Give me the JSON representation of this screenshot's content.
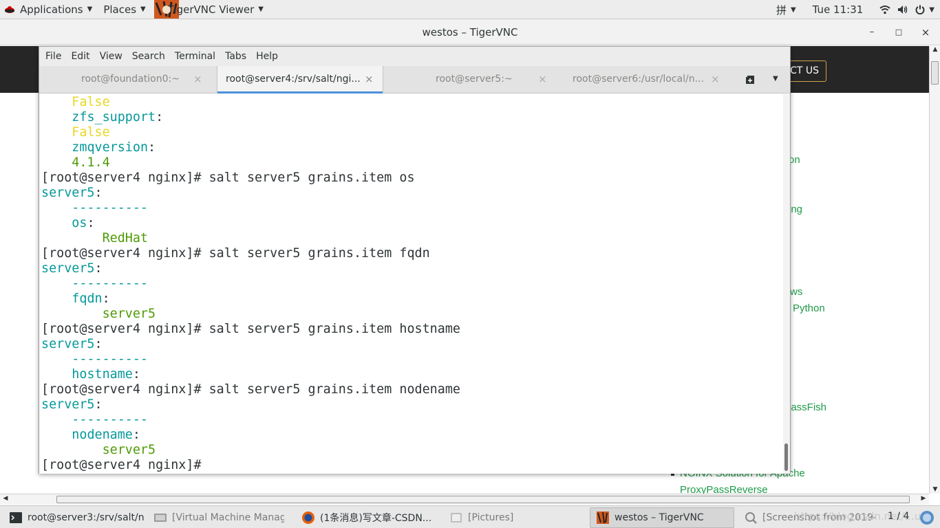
{
  "topbar": {
    "applications": "Applications",
    "places": "Places",
    "app_name": "TigerVNC Viewer",
    "input_method": "拼",
    "clock": "Tue 11:31"
  },
  "vnc_window": {
    "title": "westos – TigerVNC",
    "minimize": "–",
    "maximize": "□",
    "close": "×"
  },
  "background_page": {
    "contact": "CT US",
    "links": [
      "on",
      "ing",
      "ws",
      "Python",
      "lassFish",
      "NGINX Solution for Apache",
      "ProxyPassReverse"
    ]
  },
  "terminal": {
    "menu": [
      "File",
      "Edit",
      "View",
      "Search",
      "Terminal",
      "Tabs",
      "Help"
    ],
    "tabs": [
      {
        "label": "root@foundation0:~",
        "close": "×"
      },
      {
        "label": "root@server4:/srv/salt/ngi...",
        "close": "×"
      },
      {
        "label": "root@server5:~",
        "close": "×"
      },
      {
        "label": "root@server6:/usr/local/n...",
        "close": "×"
      }
    ],
    "lines": [
      {
        "text": "    False",
        "color": "yellow"
      },
      {
        "text": "zfs_support",
        "suffix": ":",
        "indent": 4,
        "color": "cyan"
      },
      {
        "text": "    False",
        "color": "yellow"
      },
      {
        "text": "zmqversion",
        "suffix": ":",
        "indent": 4,
        "color": "cyan"
      },
      {
        "text": "    4.1.4",
        "color": "green"
      },
      {
        "text": "[root@server4 nginx]# salt server5 grains.item os",
        "color": "fg"
      },
      {
        "text": "server5",
        "suffix": ":",
        "indent": 0,
        "color": "cyan"
      },
      {
        "text": "    ----------",
        "color": "cyan"
      },
      {
        "text": "os",
        "suffix": ":",
        "indent": 4,
        "color": "cyan"
      },
      {
        "text": "        RedHat",
        "color": "green"
      },
      {
        "text": "[root@server4 nginx]# salt server5 grains.item fqdn",
        "color": "fg"
      },
      {
        "text": "server5",
        "suffix": ":",
        "indent": 0,
        "color": "cyan"
      },
      {
        "text": "    ----------",
        "color": "cyan"
      },
      {
        "text": "fqdn",
        "suffix": ":",
        "indent": 4,
        "color": "cyan"
      },
      {
        "text": "        server5",
        "color": "green"
      },
      {
        "text": "[root@server4 nginx]# salt server5 grains.item hostname",
        "color": "fg"
      },
      {
        "text": "server5",
        "suffix": ":",
        "indent": 0,
        "color": "cyan"
      },
      {
        "text": "    ----------",
        "color": "cyan"
      },
      {
        "text": "hostname",
        "suffix": ":",
        "indent": 4,
        "color": "cyan"
      },
      {
        "text": "[root@server4 nginx]# salt server5 grains.item nodename",
        "color": "fg"
      },
      {
        "text": "server5",
        "suffix": ":",
        "indent": 0,
        "color": "cyan"
      },
      {
        "text": "    ----------",
        "color": "cyan"
      },
      {
        "text": "nodename",
        "suffix": ":",
        "indent": 4,
        "color": "cyan"
      },
      {
        "text": "        server5",
        "color": "green"
      },
      {
        "text": "[root@server4 nginx]# ",
        "color": "fg"
      }
    ]
  },
  "taskbar": {
    "items": [
      {
        "label": "root@server3:/srv/salt/n...",
        "icon": "terminal-icon"
      },
      {
        "label": "[Virtual Machine Manager]",
        "icon": "virt-manager-icon"
      },
      {
        "label": "(1条消息)写文章-CSDN...",
        "icon": "firefox-icon"
      },
      {
        "label": "[Pictures]",
        "icon": "folder-icon"
      },
      {
        "label": "westos – TigerVNC",
        "icon": "tigervnc-icon"
      },
      {
        "label": "[Screenshot from 2019-...",
        "icon": "screenshot-icon"
      }
    ],
    "workspace": "1 / 4",
    "watermark": "https://blog.csdn.net/...u..."
  },
  "colors": {
    "terminal_cyan": "#06989a",
    "terminal_yellow": "#e8d823",
    "terminal_green": "#4e9a06",
    "tab_underline": "#4a90d9",
    "link_green": "#1e9a48"
  }
}
